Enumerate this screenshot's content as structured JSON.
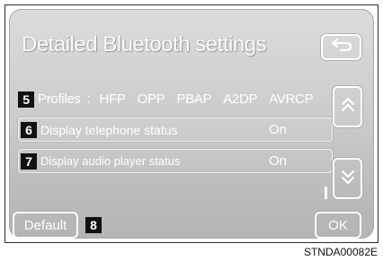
{
  "header": {
    "title": "Detailed Bluetooth settings"
  },
  "profiles_row": {
    "badge": "5",
    "label": "Profiles",
    "separator": ":",
    "items": [
      "HFP",
      "OPP",
      "PBAP",
      "A2DP",
      "AVRCP"
    ]
  },
  "telephone_row": {
    "badge": "6",
    "label": "Display telephone status",
    "value": "On"
  },
  "audio_row": {
    "badge": "7",
    "label": "Display audio player status",
    "value": "On"
  },
  "footer": {
    "default_label": "Default",
    "default_badge": "8",
    "ok_label": "OK"
  },
  "icons": {
    "back": "back-arrow-icon",
    "scroll_up": "double-chevron-up-icon",
    "scroll_down": "double-chevron-down-icon"
  },
  "figure_code": "STNDA00082E",
  "colors": {
    "screen_bg": "#d0d0d0",
    "text": "#ffffff",
    "badge_bg": "#111111"
  }
}
